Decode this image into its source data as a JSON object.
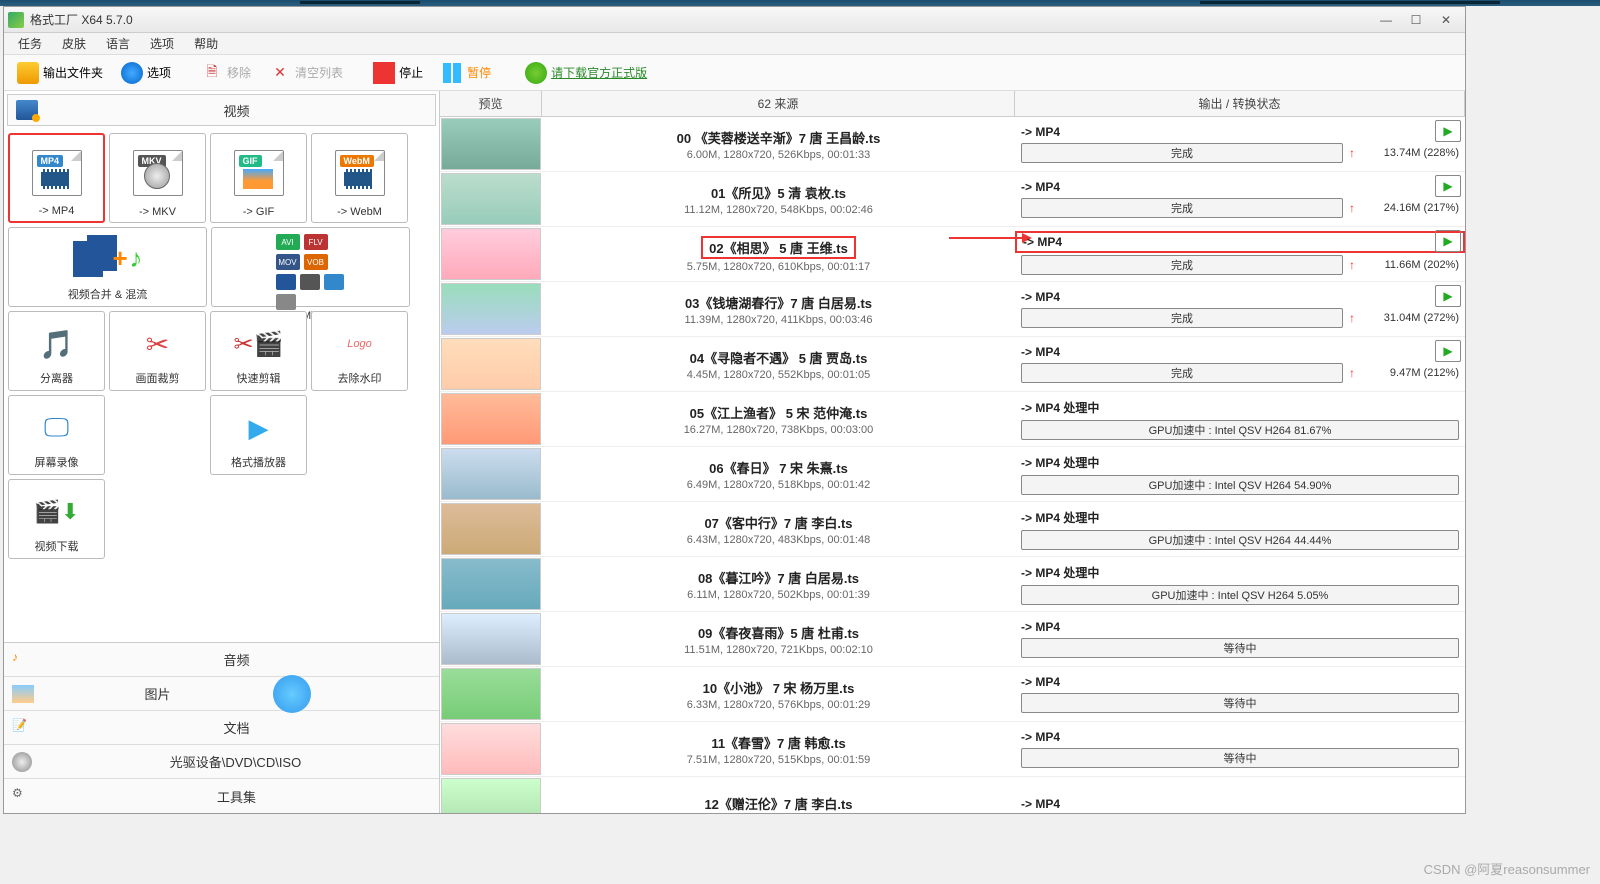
{
  "app": {
    "title": "格式工厂 X64 5.7.0"
  },
  "menu": [
    "任务",
    "皮肤",
    "语言",
    "选项",
    "帮助"
  ],
  "toolbar": {
    "output_folder": "输出文件夹",
    "options": "选项",
    "remove": "移除",
    "clear": "清空列表",
    "stop": "停止",
    "pause": "暂停",
    "download": "请下载官方正式版"
  },
  "cat_video": "视频",
  "formats": {
    "mp4": "-> MP4",
    "mkv": "-> MKV",
    "gif": "-> GIF",
    "webm": "-> WebM",
    "merge": "视频合并 & 混流",
    "avi": "-> AVI WMV MPG ....",
    "sep": "分离器",
    "crop": "画面裁剪",
    "quick": "快速剪辑",
    "wm": "去除水印",
    "screen": "屏幕录像",
    "player": "格式播放器",
    "dl": "视频下载"
  },
  "bottom_cats": {
    "audio": "音频",
    "image": "图片",
    "doc": "文档",
    "disc": "光驱设备\\DVD\\CD\\ISO",
    "tools": "工具集"
  },
  "cols": {
    "preview": "预览",
    "source": "62 来源",
    "status": "输出 / 转换状态"
  },
  "rows": [
    {
      "title": "00 《芙蓉楼送辛渐》7 唐 王昌龄.ts",
      "info": "6.00M, 1280x720, 526Kbps, 00:01:33",
      "out": "-> MP4",
      "status": "完成",
      "play": true,
      "done": true,
      "size": "13.74M  (228%)",
      "hl": false,
      "thl": false
    },
    {
      "title": "01《所见》5 清 袁枚.ts",
      "info": "11.12M, 1280x720, 548Kbps, 00:02:46",
      "out": "-> MP4",
      "status": "完成",
      "play": true,
      "done": true,
      "size": "24.16M  (217%)",
      "hl": false,
      "thl": false
    },
    {
      "title": "02《相思》 5 唐 王维.ts",
      "info": "5.75M, 1280x720, 610Kbps, 00:01:17",
      "out": "-> MP4",
      "status": "完成",
      "play": true,
      "done": true,
      "size": "11.66M  (202%)",
      "hl": true,
      "thl": true
    },
    {
      "title": "03《钱塘湖春行》7 唐 白居易.ts",
      "info": "11.39M, 1280x720, 411Kbps, 00:03:46",
      "out": "-> MP4",
      "status": "完成",
      "play": true,
      "done": true,
      "size": "31.04M  (272%)",
      "hl": false,
      "thl": false
    },
    {
      "title": "04《寻隐者不遇》 5 唐 贾岛.ts",
      "info": "4.45M, 1280x720, 552Kbps, 00:01:05",
      "out": "-> MP4",
      "status": "完成",
      "play": true,
      "done": true,
      "size": "9.47M  (212%)",
      "hl": false,
      "thl": false
    },
    {
      "title": "05《江上渔者》 5 宋 范仲淹.ts",
      "info": "16.27M, 1280x720, 738Kbps, 00:03:00",
      "out": "-> MP4 处理中",
      "status": "GPU加速中 : Intel QSV H264 81.67%",
      "play": false,
      "done": false,
      "size": "",
      "hl": false,
      "thl": false
    },
    {
      "title": "06《春日》 7 宋 朱熹.ts",
      "info": "6.49M, 1280x720, 518Kbps, 00:01:42",
      "out": "-> MP4 处理中",
      "status": "GPU加速中 : Intel QSV H264 54.90%",
      "play": false,
      "done": false,
      "size": "",
      "hl": false,
      "thl": false
    },
    {
      "title": "07《客中行》7 唐 李白.ts",
      "info": "6.43M, 1280x720, 483Kbps, 00:01:48",
      "out": "-> MP4 处理中",
      "status": "GPU加速中 : Intel QSV H264 44.44%",
      "play": false,
      "done": false,
      "size": "",
      "hl": false,
      "thl": false
    },
    {
      "title": "08《暮江吟》7 唐 白居易.ts",
      "info": "6.11M, 1280x720, 502Kbps, 00:01:39",
      "out": "-> MP4 处理中",
      "status": "GPU加速中 : Intel QSV H264 5.05%",
      "play": false,
      "done": false,
      "size": "",
      "hl": false,
      "thl": false
    },
    {
      "title": "09《春夜喜雨》5 唐 杜甫.ts",
      "info": "11.51M, 1280x720, 721Kbps, 00:02:10",
      "out": "-> MP4",
      "status": "等待中",
      "play": false,
      "done": false,
      "size": "",
      "hl": false,
      "thl": false
    },
    {
      "title": "10《小池》 7 宋 杨万里.ts",
      "info": "6.33M, 1280x720, 576Kbps, 00:01:29",
      "out": "-> MP4",
      "status": "等待中",
      "play": false,
      "done": false,
      "size": "",
      "hl": false,
      "thl": false
    },
    {
      "title": "11《春雪》7 唐 韩愈.ts",
      "info": "7.51M, 1280x720, 515Kbps, 00:01:59",
      "out": "-> MP4",
      "status": "等待中",
      "play": false,
      "done": false,
      "size": "",
      "hl": false,
      "thl": false
    },
    {
      "title": "12《赠汪伦》7 唐 李白.ts",
      "info": "",
      "out": "-> MP4",
      "status": "",
      "play": false,
      "done": false,
      "size": "",
      "hl": false,
      "thl": false
    }
  ],
  "watermark": "CSDN @阿夏reasonsummer"
}
